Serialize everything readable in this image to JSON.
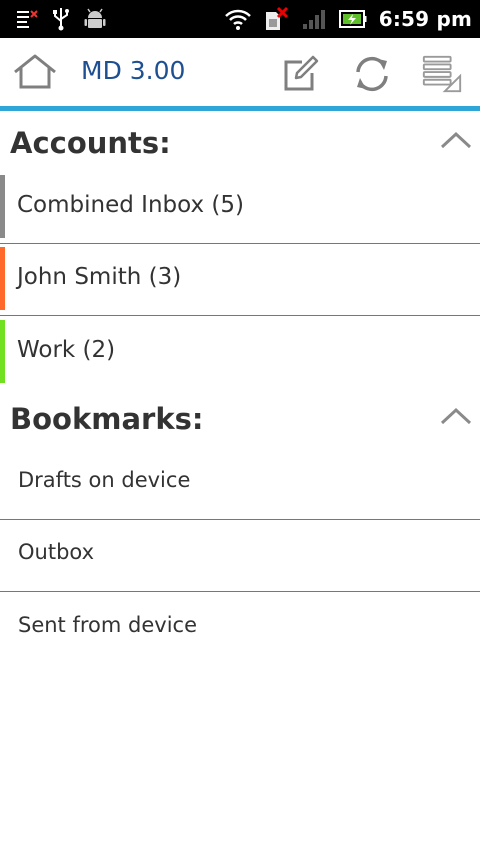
{
  "status_bar": {
    "time": "6:59 pm",
    "icons": [
      "notification-list-icon",
      "usb-icon",
      "android-debug-icon",
      "wifi-icon",
      "sim-error-icon",
      "signal-icon",
      "battery-charging-icon"
    ]
  },
  "action_bar": {
    "title": "MD 3.00",
    "colors": {
      "title": "#1d4f91",
      "accent": "#2ea7d8",
      "icon": "#7f7f7f"
    },
    "buttons": [
      "home-icon",
      "compose-icon",
      "refresh-icon",
      "menu-list-icon"
    ]
  },
  "accounts": {
    "header": "Accounts:",
    "items": [
      {
        "label": "Combined Inbox (5)",
        "color": "#8a8a8a"
      },
      {
        "label": "John Smith (3)",
        "color": "#ff6a2b"
      },
      {
        "label": "Work (2)",
        "color": "#70e020"
      }
    ]
  },
  "bookmarks": {
    "header": "Bookmarks:",
    "items": [
      {
        "label": "Drafts on device"
      },
      {
        "label": "Outbox"
      },
      {
        "label": "Sent from device"
      }
    ]
  }
}
